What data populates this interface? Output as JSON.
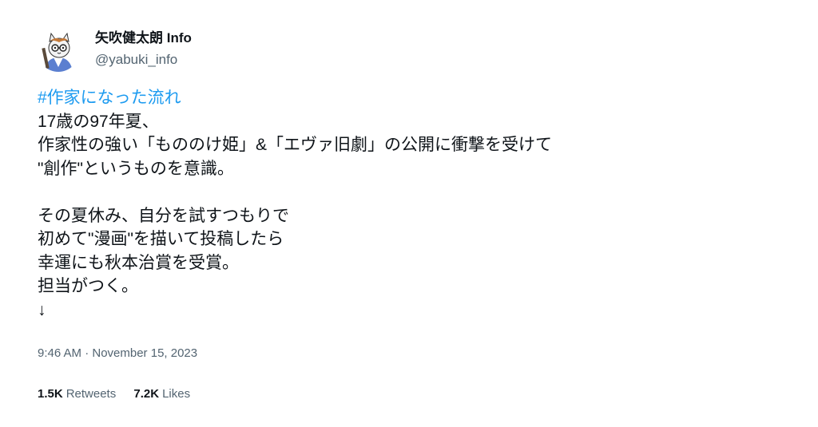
{
  "author": {
    "display_name": "矢吹健太朗 Info",
    "handle": "@yabuki_info",
    "avatar_icon": "cat-artist-avatar-icon"
  },
  "tweet": {
    "hashtag": "#作家になった流れ",
    "lines": [
      "17歳の97年夏、",
      "作家性の強い「もののけ姫」&「エヴァ旧劇」の公開に衝撃を受けて",
      "\"創作\"というものを意識。",
      "",
      "その夏休み、自分を試すつもりで",
      "初めて\"漫画\"を描いて投稿したら",
      "幸運にも秋本治賞を受賞。",
      "担当がつく。",
      "↓"
    ],
    "timestamp": "9:46 AM · November 15, 2023"
  },
  "stats": {
    "retweets_count": "1.5K",
    "retweets_label": "Retweets",
    "likes_count": "7.2K",
    "likes_label": "Likes"
  },
  "colors": {
    "link": "#1d9bf0",
    "text": "#0f1419",
    "secondary": "#536471"
  }
}
